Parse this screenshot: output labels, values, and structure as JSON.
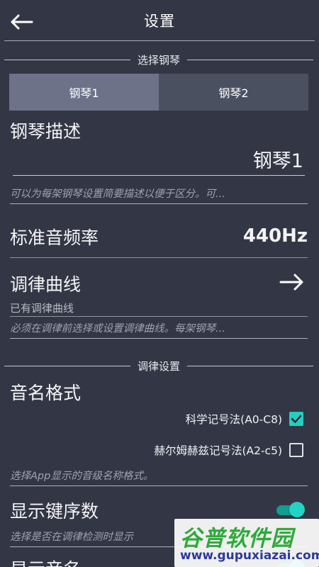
{
  "header": {
    "title": "设置",
    "back_icon": "arrow-left-icon"
  },
  "piano_section": {
    "divider": "选择钢琴",
    "tabs": [
      {
        "label": "钢琴1",
        "selected": true
      },
      {
        "label": "钢琴2",
        "selected": false
      }
    ],
    "description_label": "钢琴描述",
    "description_value": "钢琴1",
    "description_hint": "可以为每架钢琴设置简要描述以便于区分。可..."
  },
  "frequency": {
    "label": "标准音频率",
    "value": "440Hz"
  },
  "tuning_curve": {
    "label": "调律曲线",
    "sub": "已有调律曲线",
    "hint": "必须在调律前选择或设置调律曲线。每架钢琴...",
    "arrow_icon": "arrow-right-icon"
  },
  "tuning_section": {
    "divider": "调律设置"
  },
  "note_format": {
    "label": "音名格式",
    "options": [
      {
        "label": "科学记号法(A0-C8)",
        "checked": true
      },
      {
        "label": "赫尔姆赫兹记号法(A2-c5)",
        "checked": false
      }
    ],
    "hint": "选择App显示的音级名称格式。"
  },
  "key_number": {
    "label": "显示键序数",
    "hint": "选择是否在调律检测时显示",
    "enabled": true
  },
  "next_partial": {
    "label": "显示音名"
  },
  "watermark": {
    "main": "谷普软件园",
    "url": "www.gupuxiazai.com"
  },
  "colors": {
    "background": "#333745",
    "accent": "#21cfc0"
  }
}
